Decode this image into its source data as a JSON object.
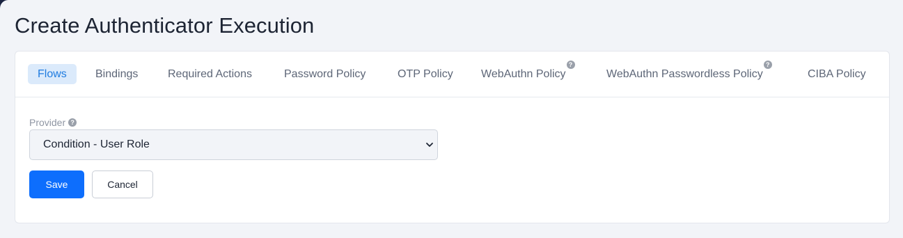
{
  "page": {
    "title": "Create Authenticator Execution"
  },
  "tabs": [
    {
      "label": "Flows",
      "active": true
    },
    {
      "label": "Bindings",
      "active": false
    },
    {
      "label": "Required Actions",
      "active": false
    },
    {
      "label": "Password Policy",
      "active": false
    },
    {
      "label": "OTP Policy",
      "active": false
    },
    {
      "label": "WebAuthn Policy",
      "active": false,
      "help_icon": "help-icon"
    },
    {
      "label": "WebAuthn Passwordless Policy",
      "active": false,
      "help_icon": "help-icon"
    },
    {
      "label": "CIBA Policy",
      "active": false
    }
  ],
  "form": {
    "provider_label": "Provider",
    "provider_help_icon": "help-icon",
    "provider_value": "Condition - User Role",
    "select_icon": "chevron-down-icon"
  },
  "buttons": {
    "save_label": "Save",
    "cancel_label": "Cancel"
  },
  "colors": {
    "accent": "#0d6efd",
    "active_tab_bg": "#dbeafb",
    "active_tab_text": "#1f7ce0",
    "page_bg": "#f2f4f8"
  }
}
